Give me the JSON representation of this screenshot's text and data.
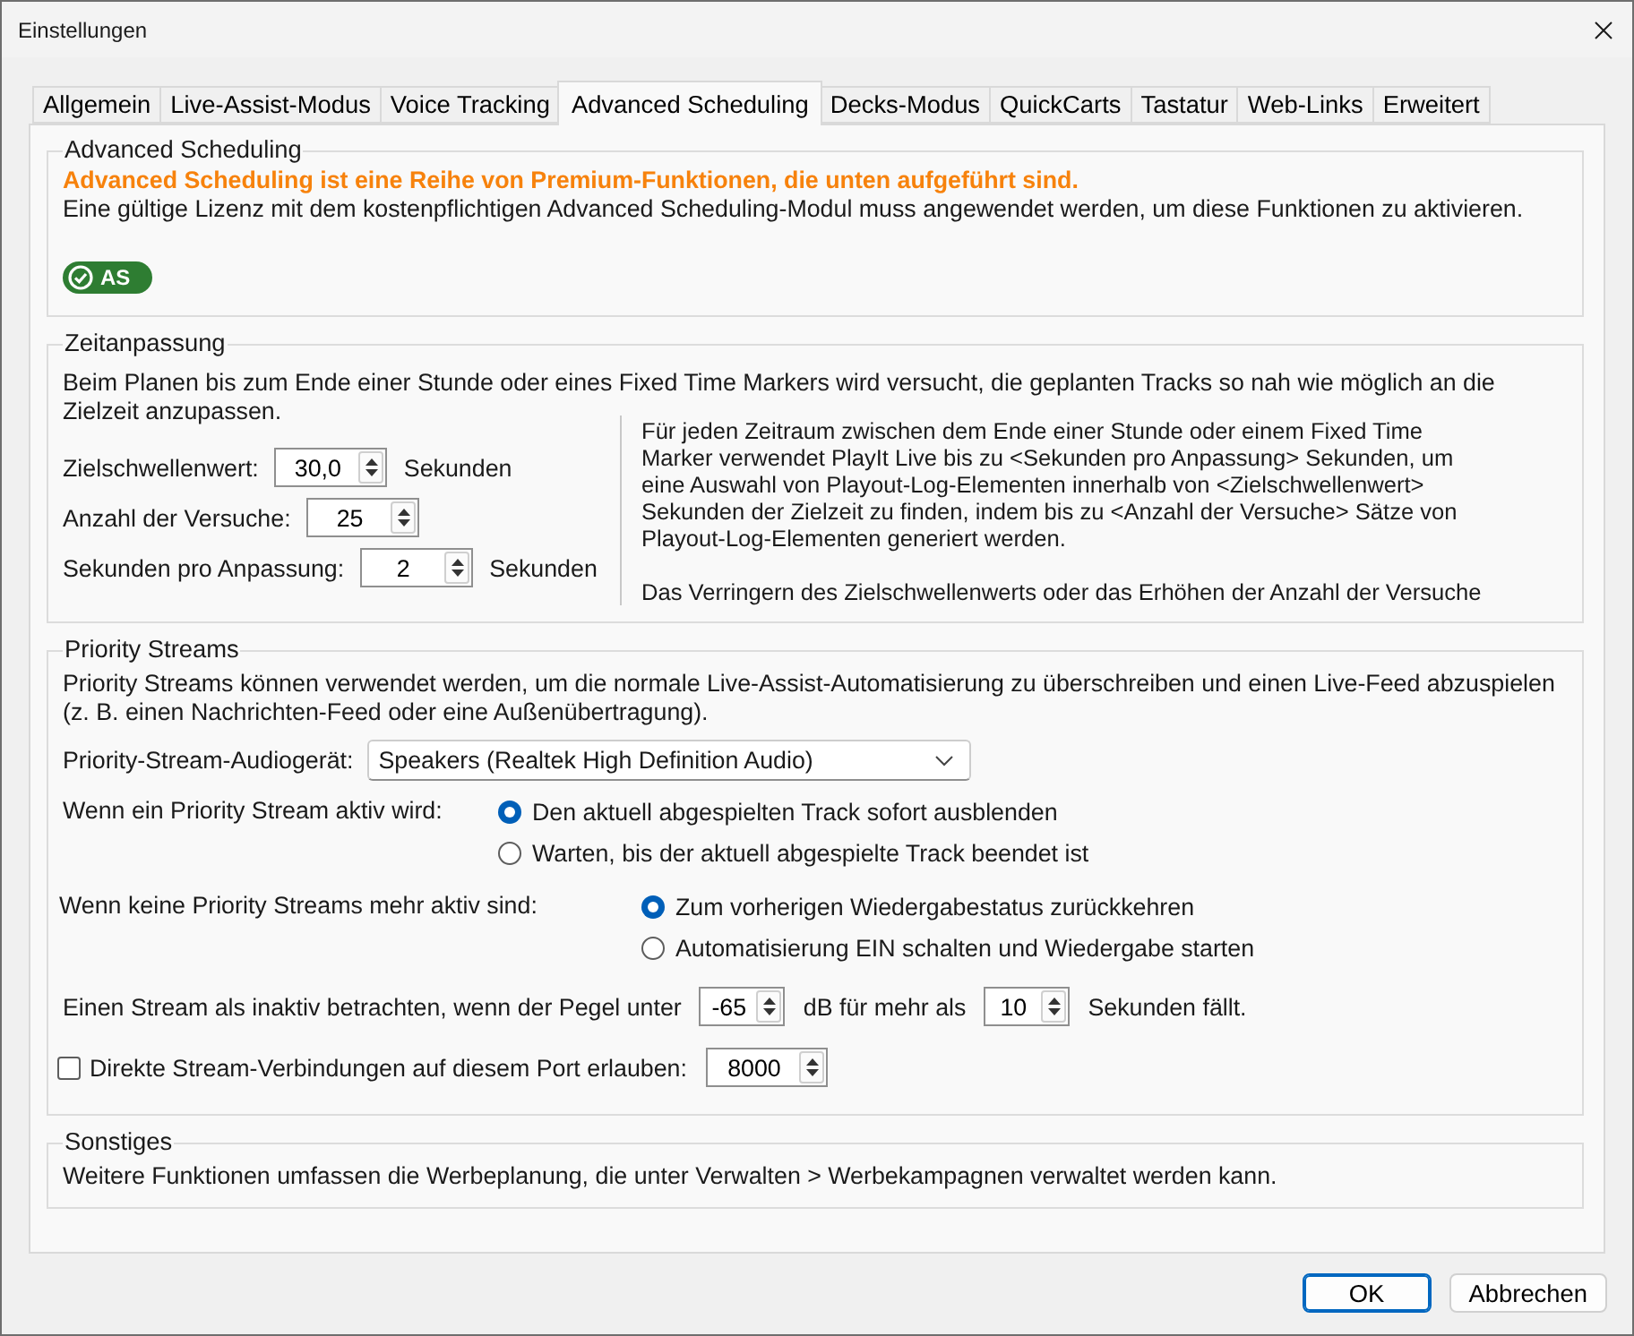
{
  "window": {
    "title": "Einstellungen"
  },
  "tabs": [
    {
      "label": "Allgemein",
      "selected": false
    },
    {
      "label": "Live-Assist-Modus",
      "selected": false
    },
    {
      "label": "Voice Tracking",
      "selected": false
    },
    {
      "label": "Advanced Scheduling",
      "selected": true
    },
    {
      "label": "Decks-Modus",
      "selected": false
    },
    {
      "label": "QuickCarts",
      "selected": false
    },
    {
      "label": "Tastatur",
      "selected": false
    },
    {
      "label": "Web-Links",
      "selected": false
    },
    {
      "label": "Erweitert",
      "selected": false
    }
  ],
  "advanced_scheduling": {
    "title": "Advanced Scheduling",
    "headline": "Advanced Scheduling ist eine Reihe von Premium-Funktionen, die unten aufgeführt sind.",
    "text": "Eine gültige Lizenz mit dem kostenpflichtigen Advanced Scheduling-Modul muss angewendet werden, um diese Funktionen zu aktivieren.",
    "badge": "AS"
  },
  "time_adjustment": {
    "title": "Zeitanpassung",
    "text": "Beim Planen bis zum Ende einer Stunde oder eines Fixed Time Markers wird versucht, die geplanten Tracks so nah wie möglich an die Zielzeit anzupassen.",
    "fields": [
      {
        "label": "Zielschwellenwert:",
        "value": "30,0",
        "unit": "Sekunden"
      },
      {
        "label": "Anzahl der Versuche:",
        "value": "25"
      },
      {
        "label": "Sekunden pro Anpassung:",
        "value": "2",
        "unit": "Sekunden"
      }
    ],
    "description": [
      "Für jeden Zeitraum zwischen dem Ende einer Stunde oder einem Fixed Time Marker verwendet PlayIt Live bis zu <Sekunden pro Anpassung> Sekunden, um eine Auswahl von Playout-Log-Elementen innerhalb von <Zielschwellenwert> Sekunden der Zielzeit zu finden, indem bis zu <Anzahl der Versuche> Sätze von Playout-Log-Elementen generiert werden.",
      "Das Verringern des Zielschwellenwerts oder das Erhöhen der Anzahl der Versuche"
    ]
  },
  "priority_streams": {
    "title": "Priority Streams",
    "text": "Priority Streams können verwendet werden, um die normale Live-Assist-Automatisierung zu überschreiben und einen Live-Feed abzuspielen (z. B. einen Nachrichten-Feed oder eine Außenübertragung).",
    "audio_device": {
      "label": "Priority-Stream-Audiogerät:",
      "value": "Speakers (Realtek High Definition Audio)"
    },
    "radio_groups": [
      {
        "label": "Wenn ein Priority Stream aktiv wird:",
        "options": [
          {
            "label": "Den aktuell abgespielten Track sofort ausblenden",
            "selected": true
          },
          {
            "label": "Warten, bis der aktuell abgespielte Track beendet ist",
            "selected": false
          }
        ]
      },
      {
        "label": "Wenn keine Priority Streams mehr aktiv sind:",
        "options": [
          {
            "label": "Zum vorherigen Wiedergabestatus zurückkehren",
            "selected": true
          },
          {
            "label": "Automatisierung EIN schalten und Wiedergabe starten",
            "selected": false
          }
        ]
      }
    ],
    "inactivity": {
      "text_before": "Einen Stream als inaktiv betrachten, wenn der Pegel unter",
      "threshold": "-65",
      "text_middle": "dB für mehr als",
      "duration": "10",
      "text_after": "Sekunden fällt."
    },
    "direct_connections": {
      "label": "Direkte Stream-Verbindungen auf diesem Port erlauben:",
      "checked": false,
      "port": "8000"
    }
  },
  "other": {
    "title": "Sonstiges",
    "text": "Weitere Funktionen umfassen die Werbeplanung, die unter Verwalten > Werbekampagnen verwaltet werden kann."
  },
  "buttons": [
    {
      "label": "OK",
      "default": true
    },
    {
      "label": "Abbrechen",
      "default": false
    }
  ]
}
